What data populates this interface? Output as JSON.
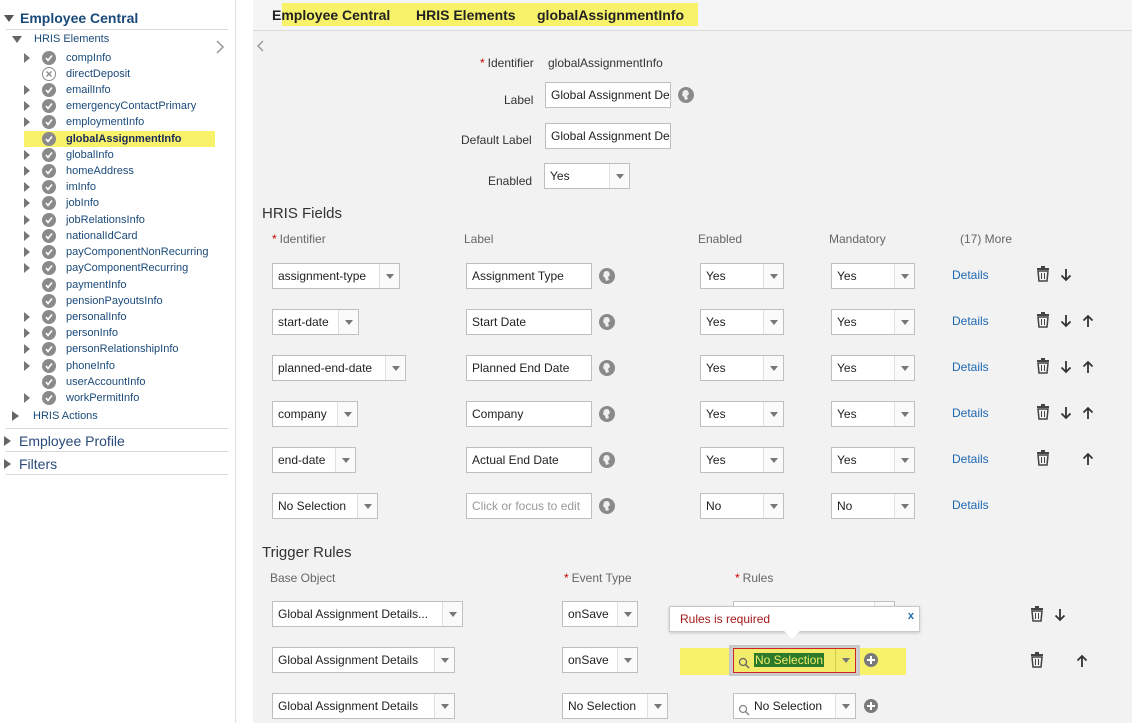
{
  "sidebar": {
    "root_employee_central": "Employee Central",
    "hris_elements": "HRIS Elements",
    "items": [
      {
        "label": "compInfo"
      },
      {
        "label": "directDeposit"
      },
      {
        "label": "emailInfo"
      },
      {
        "label": "emergencyContactPrimary"
      },
      {
        "label": "employmentInfo"
      },
      {
        "label": "globalAssignmentInfo"
      },
      {
        "label": "globalInfo"
      },
      {
        "label": "homeAddress"
      },
      {
        "label": "imInfo"
      },
      {
        "label": "jobInfo"
      },
      {
        "label": "jobRelationsInfo"
      },
      {
        "label": "nationalIdCard"
      },
      {
        "label": "payComponentNonRecurring"
      },
      {
        "label": "payComponentRecurring"
      },
      {
        "label": "paymentInfo"
      },
      {
        "label": "pensionPayoutsInfo"
      },
      {
        "label": "personalInfo"
      },
      {
        "label": "personInfo"
      },
      {
        "label": "personRelationshipInfo"
      },
      {
        "label": "phoneInfo"
      },
      {
        "label": "userAccountInfo"
      },
      {
        "label": "workPermitInfo"
      }
    ],
    "hris_actions": "HRIS Actions",
    "employee_profile": "Employee Profile",
    "filters": "Filters"
  },
  "breadcrumb": {
    "item1": "Employee Central",
    "item2": "HRIS Elements",
    "item3": "globalAssignmentInfo"
  },
  "form": {
    "required_mark": "*",
    "identifier_label": "Identifier",
    "identifier_value": "globalAssignmentInfo",
    "label_label": "Label",
    "label_value": "Global Assignment De",
    "default_label_label": "Default Label",
    "default_label_value": "Global Assignment De",
    "enabled_label": "Enabled",
    "enabled_value": "Yes"
  },
  "hris_fields": {
    "title": "HRIS Fields",
    "columns": {
      "identifier": "Identifier",
      "label": "Label",
      "enabled": "Enabled",
      "mandatory": "Mandatory",
      "more": "(17) More"
    },
    "rows": [
      {
        "identifier": "assignment-type",
        "label": "Assignment Type",
        "enabled": "Yes",
        "mandatory": "Yes",
        "details": "Details"
      },
      {
        "identifier": "start-date",
        "label": "Start Date",
        "enabled": "Yes",
        "mandatory": "Yes",
        "details": "Details"
      },
      {
        "identifier": "planned-end-date",
        "label": "Planned End Date",
        "enabled": "Yes",
        "mandatory": "Yes",
        "details": "Details"
      },
      {
        "identifier": "company",
        "label": "Company",
        "enabled": "Yes",
        "mandatory": "Yes",
        "details": "Details"
      },
      {
        "identifier": "end-date",
        "label": "Actual End Date",
        "enabled": "Yes",
        "mandatory": "Yes",
        "details": "Details"
      },
      {
        "identifier": "No Selection",
        "label_placeholder": "Click or focus to edit",
        "enabled": "No",
        "mandatory": "No",
        "details": "Details"
      }
    ]
  },
  "trigger_rules": {
    "title": "Trigger Rules",
    "columns": {
      "base_object": "Base Object",
      "event_type": "Event Type",
      "rules": "Rules"
    },
    "rows": [
      {
        "base_object": "Global Assignment Details...",
        "event_type": "onSave",
        "rules": ""
      },
      {
        "base_object": "Global Assignment Details",
        "event_type": "onSave",
        "rules": "No Selection"
      },
      {
        "base_object": "Global Assignment Details",
        "event_type": "No Selection",
        "rules": "No Selection"
      }
    ],
    "tooltip_message": "Rules is required",
    "tooltip_close": "x"
  },
  "colors": {
    "highlight": "#f7f26a",
    "link": "#1d68b0",
    "required": "#cc0000",
    "error_text": "#a41a1a"
  }
}
